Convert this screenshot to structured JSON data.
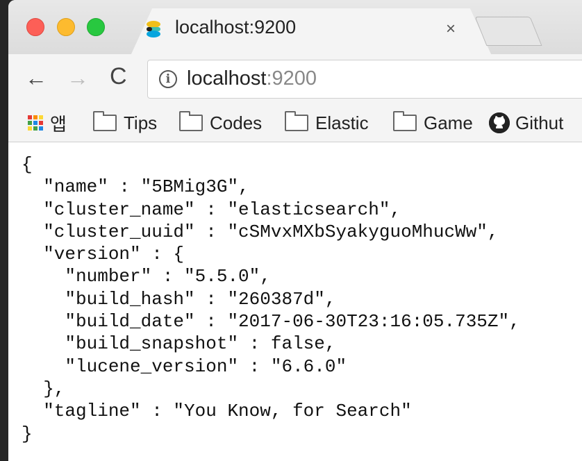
{
  "tab": {
    "title": "localhost:9200",
    "close_glyph": "×",
    "favicon": "elastic-icon"
  },
  "toolbar": {
    "back_glyph": "←",
    "forward_glyph": "→",
    "reload_glyph": "C",
    "info_glyph": "i",
    "url_host": "localhost",
    "url_port": ":9200"
  },
  "bookmarks": {
    "apps_label": "앱",
    "items": [
      {
        "label": "Tips",
        "icon": "folder-icon"
      },
      {
        "label": "Codes",
        "icon": "folder-icon"
      },
      {
        "label": "Elastic",
        "icon": "folder-icon"
      },
      {
        "label": "Game",
        "icon": "folder-icon"
      },
      {
        "label": "Githut",
        "icon": "github-icon"
      }
    ]
  },
  "json_lines": [
    "{",
    "  \"name\" : \"5BMig3G\",",
    "  \"cluster_name\" : \"elasticsearch\",",
    "  \"cluster_uuid\" : \"cSMvxMXbSyakyguoMhucWw\",",
    "  \"version\" : {",
    "    \"number\" : \"5.5.0\",",
    "    \"build_hash\" : \"260387d\",",
    "    \"build_date\" : \"2017-06-30T23:16:05.735Z\",",
    "    \"build_snapshot\" : false,",
    "    \"lucene_version\" : \"6.6.0\"",
    "  },",
    "  \"tagline\" : \"You Know, for Search\"",
    "}"
  ],
  "colors": {
    "close": "#fd5f57",
    "minimize": "#fdbb2f",
    "maximize": "#28c840"
  }
}
